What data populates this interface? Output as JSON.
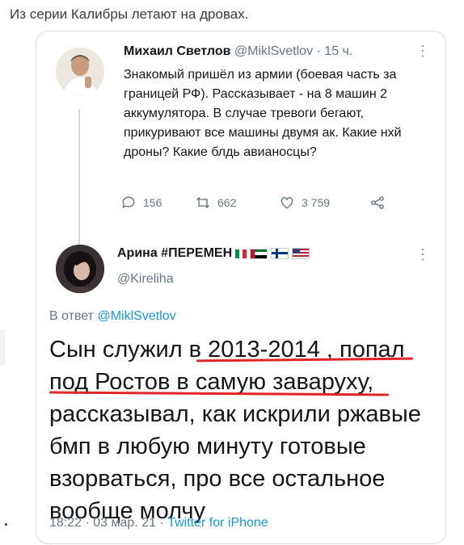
{
  "caption": "Из серии Калибры летают на дровах.",
  "original_tweet": {
    "author_name": "Михаил Светлов",
    "handle": "@MiklSvetlov",
    "time": "· 15 ч.",
    "text": "Знакомый пришёл из армии (боевая часть за границей РФ). Рассказывает - на 8 машин 2 аккумулятора. В случае тревоги бегают, прикуривают все машины двумя ак. Какие нхй дроны? Какие блдь авианосцы?",
    "replies": "156",
    "retweets": "662",
    "likes": "3 759"
  },
  "reply_tweet": {
    "author_name": "Арина #ПЕРЕМЕН",
    "handle": "@Kireliha",
    "reply_label": "В ответ",
    "reply_handle": "@MiklSvetlov",
    "text": "Сын служил в 2013-2014 , попал под Ростов в самую заваруху, рассказывал, как искрили ржавые бмп в любую минуту готовые взорваться, про все остальное вообще молчу",
    "time": "18:22 · 03 мар. 21 ·",
    "source": "Twitter for iPhone"
  },
  "colors": {
    "link": "#1b95e0",
    "muted": "#687684",
    "underline": "#e0242a"
  }
}
